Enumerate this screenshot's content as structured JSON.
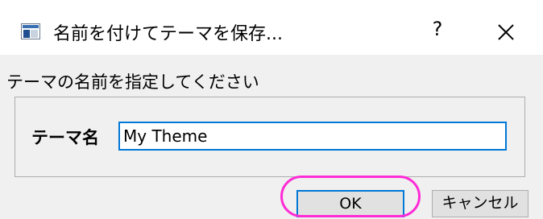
{
  "dialog": {
    "title": "名前を付けてテーマを保存...",
    "help_label": "?",
    "instruction": "テーマの名前を指定してください",
    "field_label": "テーマ名",
    "field_value": "My Theme",
    "ok_label": "OK",
    "cancel_label": "キャンセル"
  },
  "icons": {
    "app": "window-app-icon",
    "close": "close-icon"
  },
  "colors": {
    "focus_blue": "#0078d7",
    "highlight_magenta": "#ff2bd6",
    "client_bg": "#f0f0f0"
  }
}
